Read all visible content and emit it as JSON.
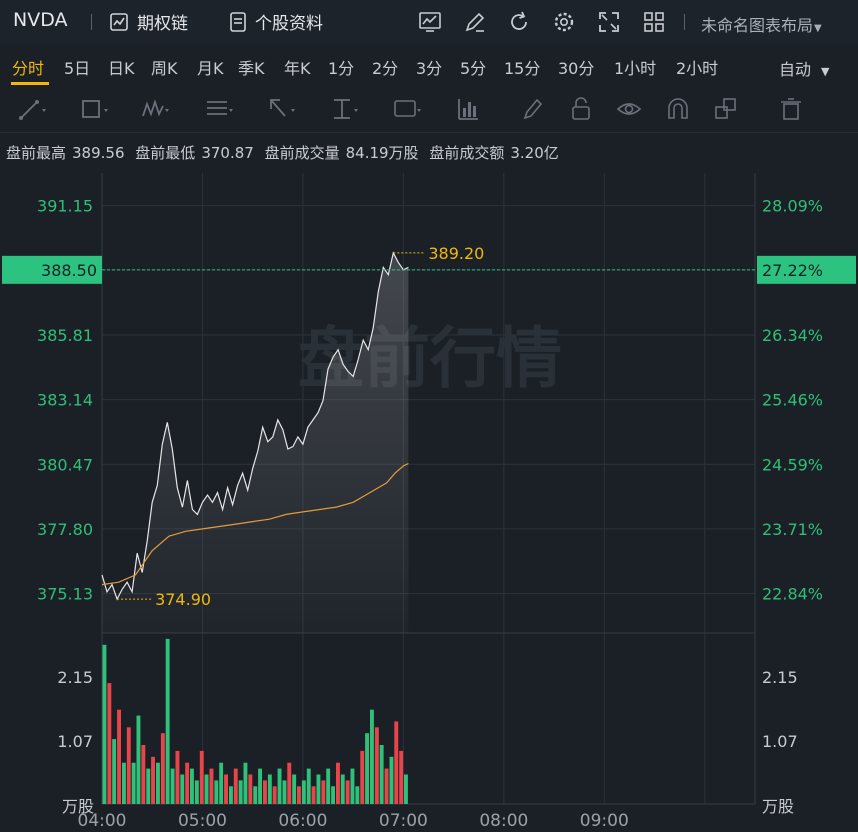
{
  "header": {
    "ticker": "NVDA",
    "options_chain": "期权链",
    "stock_profile": "个股资料",
    "layout_name": "未命名图表布局"
  },
  "periods": [
    "分时",
    "5日",
    "日K",
    "周K",
    "月K",
    "季K",
    "年K",
    "1分",
    "2分",
    "3分",
    "5分",
    "15分",
    "30分",
    "1小时",
    "2小时"
  ],
  "active_period": "分时",
  "auto_label": "自动",
  "stats": {
    "high_label": "盘前最高",
    "high_value": "389.56",
    "low_label": "盘前最低",
    "low_value": "370.87",
    "vol_label": "盘前成交量",
    "vol_value": "84.19万股",
    "amt_label": "盘前成交额",
    "amt_value": "3.20亿"
  },
  "watermark": "盘前行情",
  "colors": {
    "up": "#2fc07a",
    "down": "#e8454b",
    "accent": "#f1b80b",
    "price_line": "#e6e6e6",
    "avg_line": "#e69a3a",
    "current": "#2bc37f"
  },
  "chart_data": {
    "type": "line",
    "x_labels": [
      "04:00",
      "05:00",
      "06:00",
      "07:00",
      "08:00",
      "09:00"
    ],
    "price_ticks": [
      "391.15",
      "388.50",
      "385.81",
      "383.14",
      "380.47",
      "377.80",
      "375.13"
    ],
    "percent_ticks": [
      "28.09%",
      "27.22%",
      "26.34%",
      "25.46%",
      "24.59%",
      "23.71%",
      "22.84%"
    ],
    "volume_ticks": [
      "2.15",
      "1.07"
    ],
    "volume_unit": "万股",
    "current_price": "388.50",
    "current_percent": "27.22%",
    "max_label": "389.20",
    "min_label": "374.90",
    "ylim": [
      373.5,
      392.5
    ],
    "price_series": {
      "t": [
        0,
        3,
        6,
        9,
        12,
        15,
        18,
        21,
        24,
        27,
        30,
        33,
        36,
        39,
        42,
        45,
        48,
        51,
        54,
        57,
        60,
        63,
        66,
        69,
        72,
        75,
        78,
        81,
        84,
        87,
        90,
        93,
        96,
        99,
        102,
        105,
        108,
        111,
        114,
        117,
        120,
        123,
        126,
        129,
        132,
        135,
        138,
        141,
        144,
        147,
        150,
        153,
        156,
        159,
        162,
        165
      ],
      "v": [
        375.9,
        375.2,
        375.5,
        374.9,
        375.3,
        375.6,
        375.2,
        376.8,
        376.0,
        377.3,
        378.9,
        379.6,
        381.3,
        382.2,
        381.1,
        379.5,
        378.7,
        379.8,
        378.6,
        378.4,
        378.9,
        379.2,
        378.9,
        379.3,
        378.6,
        379.5,
        378.8,
        379.6,
        380.1,
        379.4,
        380.3,
        381.0,
        382.0,
        381.4,
        381.6,
        382.3,
        381.9,
        381.1,
        381.2,
        381.6,
        381.3,
        382.0,
        382.3,
        382.6,
        383.1,
        384.4,
        384.9,
        385.2,
        384.6,
        384.3,
        384.1,
        384.8,
        385.6,
        385.2,
        386.1,
        387.6
      ],
      "tail_t": [
        168,
        171,
        174,
        177,
        180,
        183
      ],
      "tail_v": [
        388.6,
        388.3,
        389.2,
        388.8,
        388.5,
        388.6
      ]
    },
    "avg_series": {
      "t": [
        0,
        10,
        20,
        30,
        40,
        50,
        60,
        70,
        80,
        90,
        100,
        110,
        120,
        130,
        140,
        150,
        160,
        170,
        175,
        180,
        183
      ],
      "v": [
        375.5,
        375.6,
        375.9,
        376.9,
        377.5,
        377.7,
        377.8,
        377.9,
        378.0,
        378.1,
        378.2,
        378.4,
        378.5,
        378.6,
        378.7,
        378.9,
        379.3,
        379.7,
        380.1,
        380.4,
        380.5
      ]
    },
    "volume_max": 2.9,
    "volumes": [
      2.7,
      2.05,
      1.1,
      1.6,
      0.7,
      1.3,
      0.7,
      1.5,
      1.0,
      0.6,
      0.8,
      0.7,
      1.2,
      2.8,
      0.6,
      0.9,
      0.5,
      0.7,
      0.6,
      0.4,
      0.9,
      0.5,
      0.6,
      0.4,
      0.7,
      0.5,
      0.3,
      0.6,
      0.4,
      0.7,
      0.5,
      0.3,
      0.6,
      0.4,
      0.5,
      0.3,
      0.6,
      0.4,
      0.7,
      0.5,
      0.3,
      0.4,
      0.6,
      0.3,
      0.5,
      0.4,
      0.6,
      0.3,
      0.7,
      0.5,
      0.4,
      0.6,
      0.3,
      0.9,
      1.2,
      1.6,
      1.3,
      1.0,
      0.6,
      0.8,
      1.4,
      0.9,
      0.5
    ],
    "volume_dirs": [
      1,
      0,
      1,
      0,
      1,
      0,
      1,
      1,
      0,
      1,
      0,
      1,
      0,
      1,
      1,
      0,
      1,
      0,
      1,
      1,
      0,
      1,
      0,
      1,
      1,
      0,
      1,
      0,
      1,
      1,
      0,
      1,
      1,
      0,
      1,
      0,
      1,
      1,
      0,
      1,
      0,
      1,
      1,
      0,
      1,
      0,
      1,
      1,
      0,
      1,
      0,
      1,
      1,
      0,
      1,
      1,
      0,
      1,
      0,
      1,
      0,
      0,
      1
    ]
  }
}
